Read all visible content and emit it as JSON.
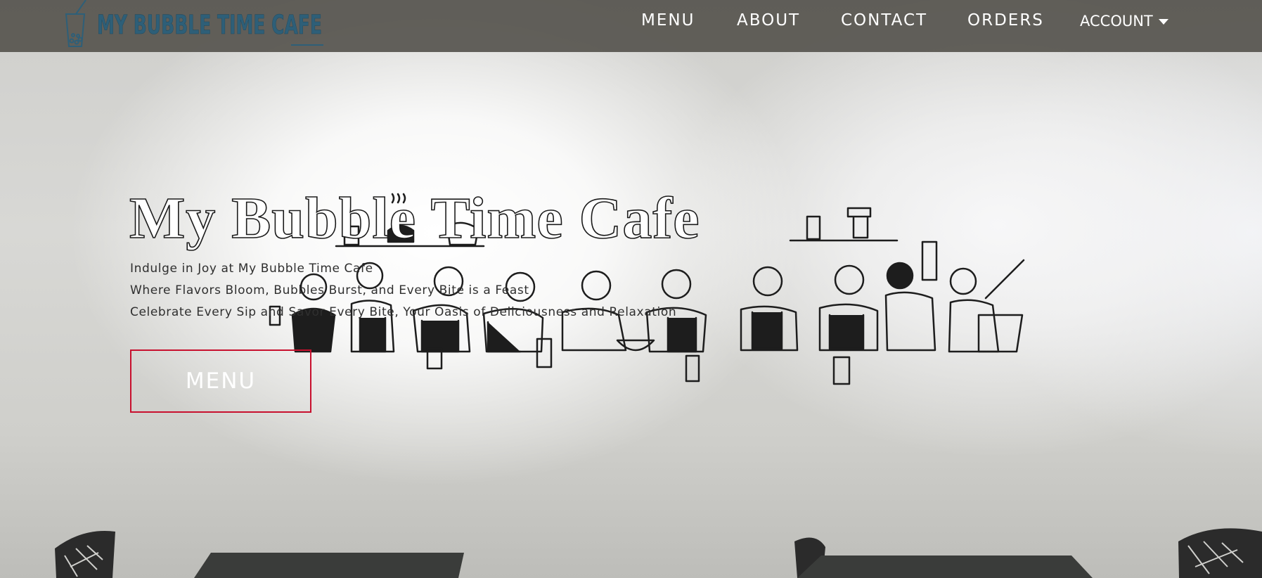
{
  "brand": {
    "logo_text": "MY BUBBLE TIME CAFE",
    "logo_icon": "bubble-tea-cup-icon"
  },
  "nav": {
    "menu": "MENU",
    "about": "ABOUT",
    "contact": "CONTACT",
    "orders": "ORDERS",
    "account": "ACCOUNT"
  },
  "hero": {
    "title": "My Bubble Time Cafe",
    "tagline_1": "Indulge in Joy at My Bubble Time Cafe",
    "tagline_2": "Where Flavors Bloom, Bubbles Burst, and Every Bite is a Feast",
    "tagline_3": "Celebrate Every Sip and Savor Every Bite, Your Oasis of Deliciousness and Relaxation",
    "cta_label": "MENU"
  },
  "colors": {
    "nav_background": "#56544e",
    "cta_border": "#c8102e",
    "logo_color": "#2e5f78"
  }
}
